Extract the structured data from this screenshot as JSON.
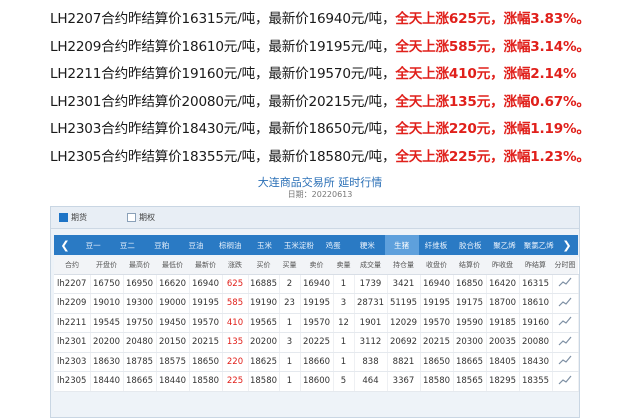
{
  "summary_lines": [
    {
      "text": "LH2207合约昨结算价16315元/吨，最新价16940元/吨，",
      "highlight": "全天上涨625元，涨幅3.83%。"
    },
    {
      "text": "LH2209合约昨结算价18610元/吨，最新价19195元/吨，",
      "highlight": "全天上涨585元，涨幅3.14%。"
    },
    {
      "text": "LH2211合约昨结算价19160元/吨，最新价19570元/吨，",
      "highlight": "全天上涨410元，涨幅2.14%"
    },
    {
      "text": "LH2301合约昨结算价20080元/吨，最新价20215元/吨，",
      "highlight": "全天上涨135元，涨幅0.67%。"
    },
    {
      "text": "LH2303合约昨结算价18430元/吨，最新价18650元/吨，",
      "highlight": "全天上涨220元，涨幅1.19%。"
    },
    {
      "text": "LH2305合约昨结算价18355元/吨，最新价18580元/吨，",
      "highlight": "全天上涨225元，涨幅1.23%。"
    }
  ],
  "exchange": {
    "title": "大连商品交易所 延时行情",
    "date": "日期：20220613"
  },
  "filters": [
    {
      "label": "期货",
      "checked": true
    },
    {
      "label": "期权",
      "checked": false
    }
  ],
  "nav": {
    "prev_icon": "chevron-left-icon",
    "next_icon": "chevron-right-icon",
    "tabs": [
      "豆一",
      "豆二",
      "豆粕",
      "豆油",
      "棕榈油",
      "玉米",
      "玉米淀粉",
      "鸡蛋",
      "粳米",
      "生猪",
      "纤维板",
      "胶合板",
      "聚乙烯",
      "聚氯乙烯"
    ],
    "active_tab": "生猪"
  },
  "table": {
    "headers": [
      "合约",
      "开盘价",
      "最高价",
      "最低价",
      "最新价",
      "涨跌",
      "买价",
      "买量",
      "卖价",
      "卖量",
      "成交量",
      "持仓量",
      "收盘价",
      "结算价",
      "昨收盘",
      "昨结算",
      "分时图"
    ],
    "rows": [
      [
        "lh2207",
        "16750",
        "16950",
        "16620",
        "16940",
        "625",
        "16885",
        "2",
        "16940",
        "1",
        "1739",
        "3421",
        "16940",
        "16850",
        "16420",
        "16315"
      ],
      [
        "lh2209",
        "19010",
        "19300",
        "19000",
        "19195",
        "585",
        "19190",
        "23",
        "19195",
        "3",
        "28731",
        "51195",
        "19195",
        "19175",
        "18700",
        "18610"
      ],
      [
        "lh2211",
        "19545",
        "19750",
        "19450",
        "19570",
        "410",
        "19565",
        "1",
        "19570",
        "12",
        "1901",
        "12029",
        "19570",
        "19590",
        "19185",
        "19160"
      ],
      [
        "lh2301",
        "20200",
        "20480",
        "20150",
        "20215",
        "135",
        "20200",
        "3",
        "20225",
        "1",
        "3112",
        "20692",
        "20215",
        "20300",
        "20035",
        "20080"
      ],
      [
        "lh2303",
        "18630",
        "18785",
        "18575",
        "18650",
        "220",
        "18625",
        "1",
        "18660",
        "1",
        "838",
        "8821",
        "18650",
        "18665",
        "18405",
        "18430"
      ],
      [
        "lh2305",
        "18440",
        "18665",
        "18440",
        "18580",
        "225",
        "18580",
        "1",
        "18600",
        "5",
        "464",
        "3367",
        "18580",
        "18565",
        "18295",
        "18355"
      ]
    ],
    "change_color": "#e0201b",
    "chart_icon": "trend-line-icon"
  },
  "colors": {
    "accent": "#2a7ac4",
    "active_tab": "#5ea0dc",
    "rise": "#e0201b"
  }
}
